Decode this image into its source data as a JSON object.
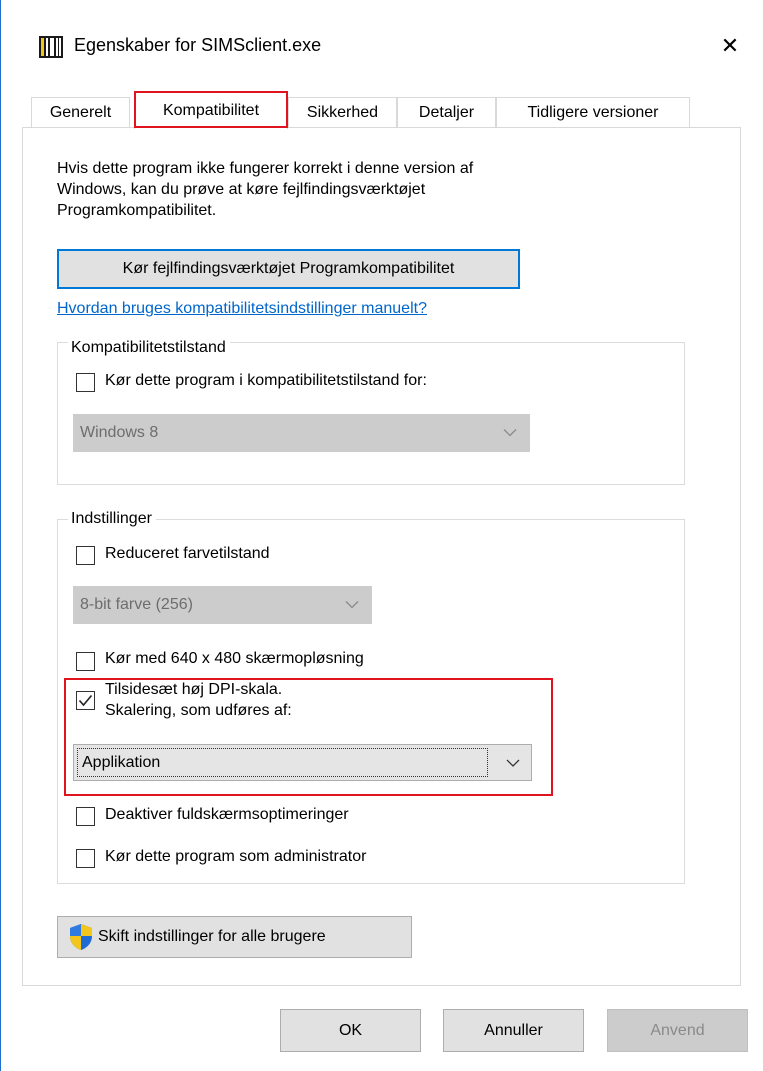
{
  "window": {
    "title": "Egenskaber for SIMSclient.exe",
    "close_glyph": "✕",
    "app_icon": "simsclient-app-icon"
  },
  "tabs": [
    {
      "label": "Generelt",
      "active": false
    },
    {
      "label": "Kompatibilitet",
      "active": true
    },
    {
      "label": "Sikkerhed",
      "active": false
    },
    {
      "label": "Detaljer",
      "active": false
    },
    {
      "label": "Tidligere versioner",
      "active": false
    }
  ],
  "description": {
    "line1": "Hvis dette program ikke fungerer korrekt i denne version af",
    "line2": "Windows, kan du prøve at køre fejlfindingsværktøjet",
    "line3": "Programkompatibilitet."
  },
  "troubleshoot_button": "Kør fejlfindingsværktøjet Programkompatibilitet",
  "help_link": "Hvordan bruges kompatibilitetsindstillinger manuelt?",
  "compat_mode": {
    "legend": "Kompatibilitetstilstand",
    "checkbox_label": "Kør dette program i kompatibilitetstilstand for:",
    "checked": false,
    "select_value": "Windows 8",
    "select_disabled": true
  },
  "settings": {
    "legend": "Indstillinger",
    "reduced_color": {
      "label": "Reduceret farvetilstand",
      "checked": false
    },
    "color_select": {
      "value": "8-bit farve (256)",
      "disabled": true
    },
    "low_res": {
      "label": "Kør med 640 x 480 skærmopløsning",
      "checked": false
    },
    "high_dpi": {
      "label_line1": "Tilsidesæt høj DPI-skala.",
      "label_line2": "Skalering, som udføres af:",
      "checked": true
    },
    "dpi_select": {
      "value": "Applikation"
    },
    "fullscreen_opt": {
      "label": "Deaktiver fuldskærmsoptimeringer",
      "checked": false
    },
    "run_admin": {
      "label": "Kør dette program som administrator",
      "checked": false
    }
  },
  "all_users_button": {
    "label": "Skift indstillinger for alle brugere",
    "icon": "uac-shield-icon"
  },
  "footer": {
    "ok": "OK",
    "cancel": "Annuller",
    "apply": "Anvend"
  },
  "colors": {
    "highlight_red": "#e0141e",
    "focus_blue": "#0078d7",
    "link_blue": "#0066cc",
    "disabled_gray": "#cccccc"
  }
}
